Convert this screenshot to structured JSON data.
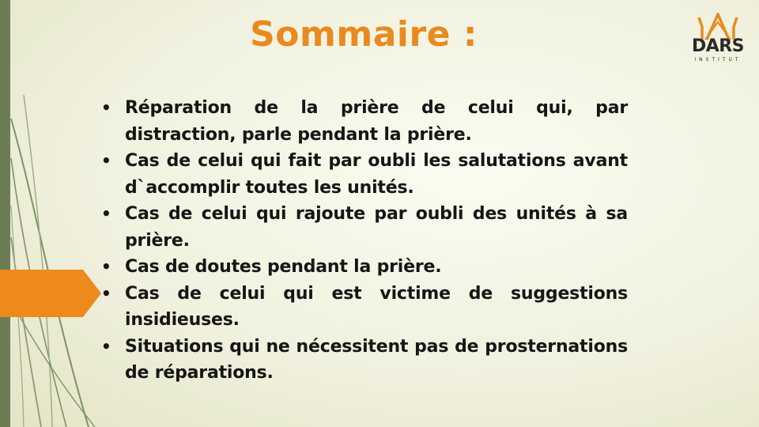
{
  "slide": {
    "title": "Sommaire :",
    "logo": {
      "name": "DARS",
      "subtitle": "INSTITUT"
    },
    "bullet_symbol": "•",
    "items": [
      "Réparation de la prière de celui qui, par distraction, parle pendant la prière.",
      "Cas de celui qui fait par oubli les salutations avant d`accomplir toutes les unités.",
      "Cas de celui qui rajoute par oubli des unités à sa prière.",
      "Cas de doutes pendant la prière.",
      "Cas de celui qui est victime de suggestions insidieuses.",
      "Situations qui ne nécessitent pas de prosternations de réparations."
    ],
    "colors": {
      "title": "#e98a1f",
      "accent_arrow": "#ee8a1b",
      "left_bar": "#6b7d55",
      "body_text": "#161616",
      "background": "#f3f3e4"
    },
    "icons": [
      "dars-logo",
      "orange-arrow-shape",
      "green-leaf-lines"
    ]
  }
}
